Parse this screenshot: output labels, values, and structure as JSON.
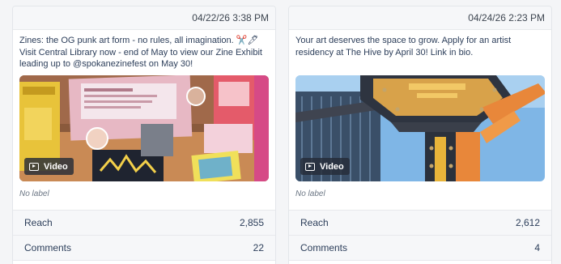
{
  "posts": [
    {
      "timestamp": "04/22/26 3:38 PM",
      "caption": "Zines: the OG punk art form - no rules, all imagination. ✂️🖊 Visit Central Library now - end of May to view our Zine Exhibit leading up to @spokanezinefest on May 30!",
      "media_type": "Video",
      "label": "No label",
      "metrics": [
        {
          "label": "Reach",
          "value": "2,855"
        },
        {
          "label": "Comments",
          "value": "22"
        }
      ]
    },
    {
      "timestamp": "04/24/26 2:23 PM",
      "caption": "Your art deserves the space to grow. Apply for an artist residency at The Hive by April 30! Link in bio.",
      "media_type": "Video",
      "label": "No label",
      "metrics": [
        {
          "label": "Reach",
          "value": "2,612"
        },
        {
          "label": "Comments",
          "value": "4"
        }
      ]
    }
  ]
}
